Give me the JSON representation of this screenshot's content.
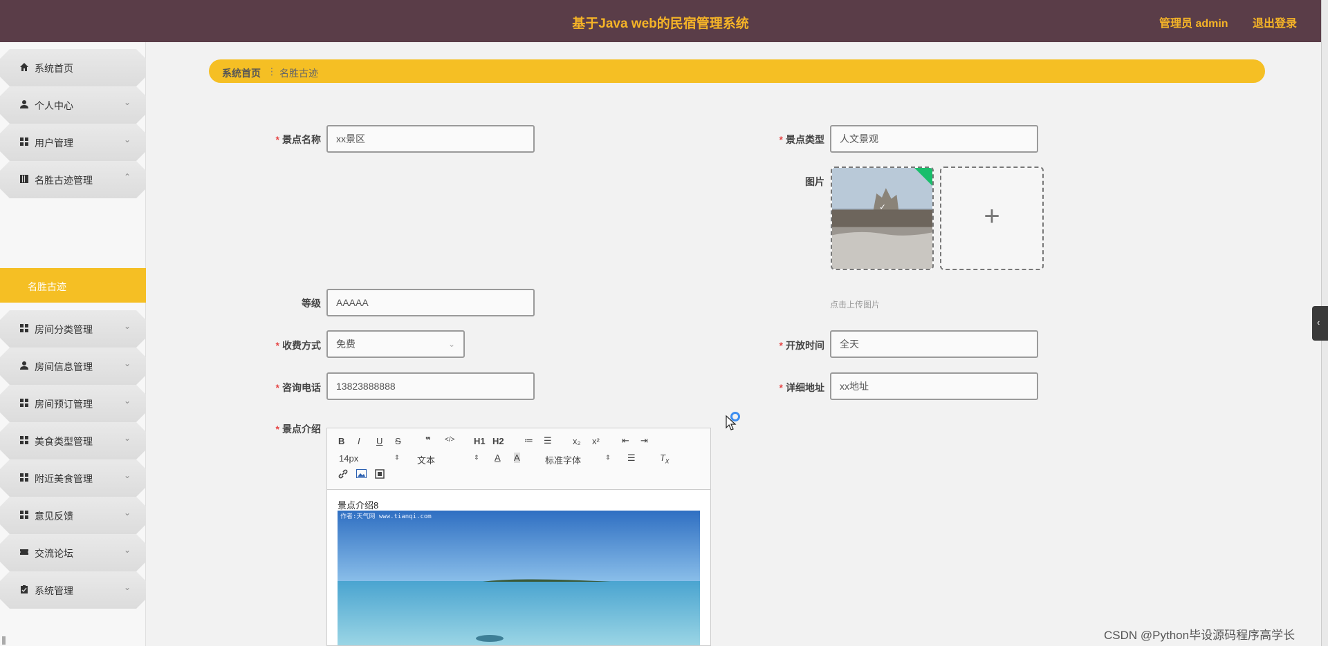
{
  "header": {
    "title": "基于Java web的民宿管理系统",
    "user": "管理员 admin",
    "logout": "退出登录",
    "bg_color": "#5a3d48",
    "accent_color": "#f5b427"
  },
  "sidebar": {
    "items": [
      {
        "label": "系统首页",
        "icon": "home-icon",
        "arrow": ""
      },
      {
        "label": "个人中心",
        "icon": "user-icon",
        "arrow": "⌄"
      },
      {
        "label": "用户管理",
        "icon": "grid-icon",
        "arrow": "⌄"
      },
      {
        "label": "名胜古迹管理",
        "icon": "book-icon",
        "arrow": "⌃"
      },
      {
        "label": "房间分类管理",
        "icon": "grid-icon",
        "arrow": "⌄"
      },
      {
        "label": "房间信息管理",
        "icon": "user-icon",
        "arrow": "⌄"
      },
      {
        "label": "房间预订管理",
        "icon": "grid-icon",
        "arrow": "⌄"
      },
      {
        "label": "美食类型管理",
        "icon": "grid-icon",
        "arrow": "⌄"
      },
      {
        "label": "附近美食管理",
        "icon": "grid-icon",
        "arrow": "⌄"
      },
      {
        "label": "意见反馈",
        "icon": "grid-icon",
        "arrow": "⌄"
      },
      {
        "label": "交流论坛",
        "icon": "ticket-icon",
        "arrow": "⌄"
      },
      {
        "label": "系统管理",
        "icon": "clipboard-icon",
        "arrow": "⌄"
      }
    ],
    "active_sub": "名胜古迹",
    "active_color": "#f5bf24"
  },
  "breadcrumb": {
    "home": "系统首页",
    "separator": "⋮",
    "current": "名胜古迹"
  },
  "form": {
    "name": {
      "label": "景点名称",
      "value": "xx景区"
    },
    "type": {
      "label": "景点类型",
      "value": "人文景观"
    },
    "image": {
      "label": "图片",
      "tip": "点击上传图片",
      "add_symbol": "+"
    },
    "level": {
      "label": "等级",
      "value": "AAAAA"
    },
    "fee": {
      "label": "收费方式",
      "value": "免费"
    },
    "open_time": {
      "label": "开放时间",
      "value": "全天"
    },
    "phone": {
      "label": "咨询电话",
      "value": "13823888888"
    },
    "address": {
      "label": "详细地址",
      "value": "xx地址"
    },
    "intro": {
      "label": "景点介绍",
      "text": "景点介绍8",
      "watermark": "作者:天气网 www.tianqi.com"
    },
    "required_mark": "*"
  },
  "editor": {
    "toolbar_row1": [
      "B",
      "I",
      "U",
      "S",
      "❞",
      "</>",
      "H1",
      "H2",
      "≔",
      "☰",
      "x₂",
      "x²",
      "⇤",
      "⇥"
    ],
    "size": "14px",
    "para": "文本",
    "font": "标准字体"
  },
  "watermark": "CSDN @Python毕设源码程序高学长"
}
